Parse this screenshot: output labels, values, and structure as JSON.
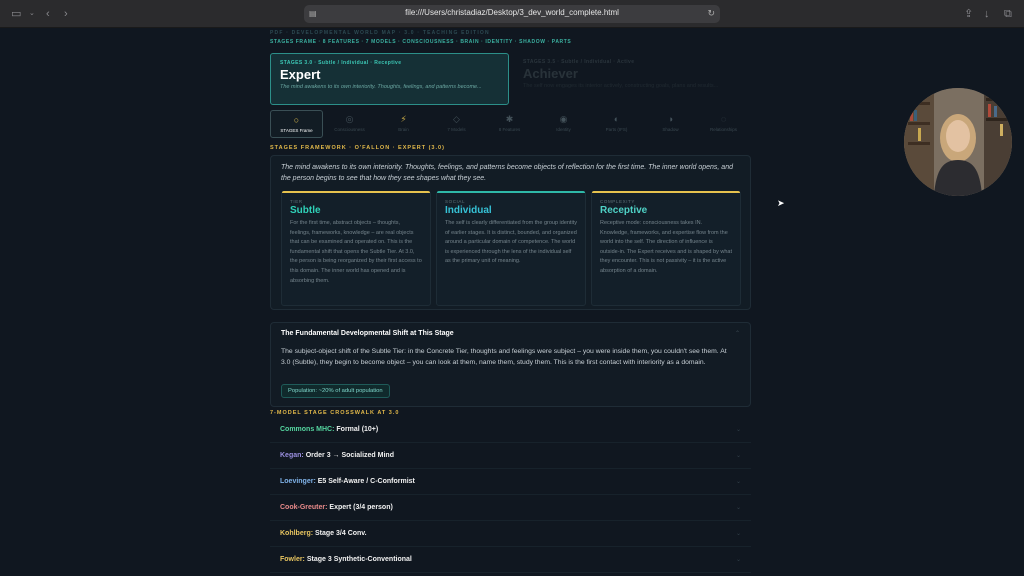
{
  "browser": {
    "url": "file:///Users/christadiaz/Desktop/3_dev_world_complete.html"
  },
  "header": {
    "line1": "PDF · DEVELOPMENTAL WORLD MAP · 3.0 · TEACHING EDITION",
    "line2": "STAGES FRAME · 8 FEATURES · 7 MODELS · CONSCIOUSNESS · BRAIN · IDENTITY · SHADOW · PARTS"
  },
  "stages": {
    "active": {
      "label": "STAGES 3.0 · Subtle / Individual · Receptive",
      "title": "Expert",
      "desc": "The mind awakens to its own interiority. Thoughts, feelings, and patterns become..."
    },
    "next": {
      "label": "STAGES 3.5 · Subtle / Individual · Active",
      "title": "Achiever",
      "desc": "The self now engages its interior actively, constructing goals, plans and results..."
    }
  },
  "tabs": [
    {
      "icon": "○",
      "label": "STAGES Frame"
    },
    {
      "icon": "◎",
      "label": "Consciousness"
    },
    {
      "icon": "⚡",
      "label": "Brain"
    },
    {
      "icon": "◇",
      "label": "7 Models"
    },
    {
      "icon": "✱",
      "label": "8 Features"
    },
    {
      "icon": "◉",
      "label": "Identity"
    },
    {
      "icon": "◐",
      "label": "Parts (IFS)"
    },
    {
      "icon": "◑",
      "label": "Shadow"
    },
    {
      "icon": "◌",
      "label": "Relationships"
    }
  ],
  "framework": {
    "section_label": "STAGES FRAMEWORK · O'FALLON · EXPERT (3.0)",
    "intro": "The mind awakens to its own interiority. Thoughts, feelings, and patterns become objects of reflection for the first time. The inner world opens, and the person begins to see that how they see shapes what they see.",
    "cards": [
      {
        "kicker": "TIER",
        "title": "Subtle",
        "color": "#2fd1b8",
        "body": "For the first time, abstract objects – thoughts, feelings, frameworks, knowledge – are real objects that can be examined and operated on. This is the fundamental shift that opens the Subtle Tier. At 3.0, the person is being reorganized by their first access to this domain. The inner world has opened and is absorbing them."
      },
      {
        "kicker": "SOCIAL",
        "title": "Individual",
        "color": "#36c2d6",
        "body": "The self is clearly differentiated from the group identity of earlier stages. It is distinct, bounded, and organized around a particular domain of competence. The world is experienced through the lens of the individual self as the primary unit of meaning."
      },
      {
        "kicker": "COMPLEXITY",
        "title": "Receptive",
        "color": "#4fd2c6",
        "body": "Receptive mode: consciousness takes IN. Knowledge, frameworks, and expertise flow from the world into the self. The direction of influence is outside-in. The Expert receives and is shaped by what they encounter. This is not passivity – it is the active absorption of a domain."
      }
    ]
  },
  "shift": {
    "title": "The Fundamental Developmental Shift at This Stage",
    "body": "The subject-object shift of the Subtle Tier: in the Concrete Tier, thoughts and feelings were subject – you were inside them, you couldn't see them. At 3.0 (Subtle), they begin to become object – you can look at them, name them, study them. This is the first contact with interiority as a domain.",
    "population": "Population: ~20% of adult population"
  },
  "crosswalk": {
    "section_label": "7-MODEL STAGE CROSSWALK AT 3.0",
    "rows": [
      {
        "model": "Commons MHC:",
        "value": "Formal (10+)",
        "color": "#55d6a0"
      },
      {
        "model": "Kegan:",
        "value": "Order 3 → Socialized Mind",
        "color": "#9a8fe0"
      },
      {
        "model": "Loevinger:",
        "value": "E5 Self-Aware / C-Conformist",
        "color": "#7fb2e8"
      },
      {
        "model": "Cook-Greuter:",
        "value": "Expert (3/4 person)",
        "color": "#e88a8a"
      },
      {
        "model": "Kohlberg:",
        "value": "Stage 3/4 Conv.",
        "color": "#e8c560"
      },
      {
        "model": "Fowler:",
        "value": "Stage 3 Synthetic-Conventional",
        "color": "#e8c560"
      }
    ]
  }
}
